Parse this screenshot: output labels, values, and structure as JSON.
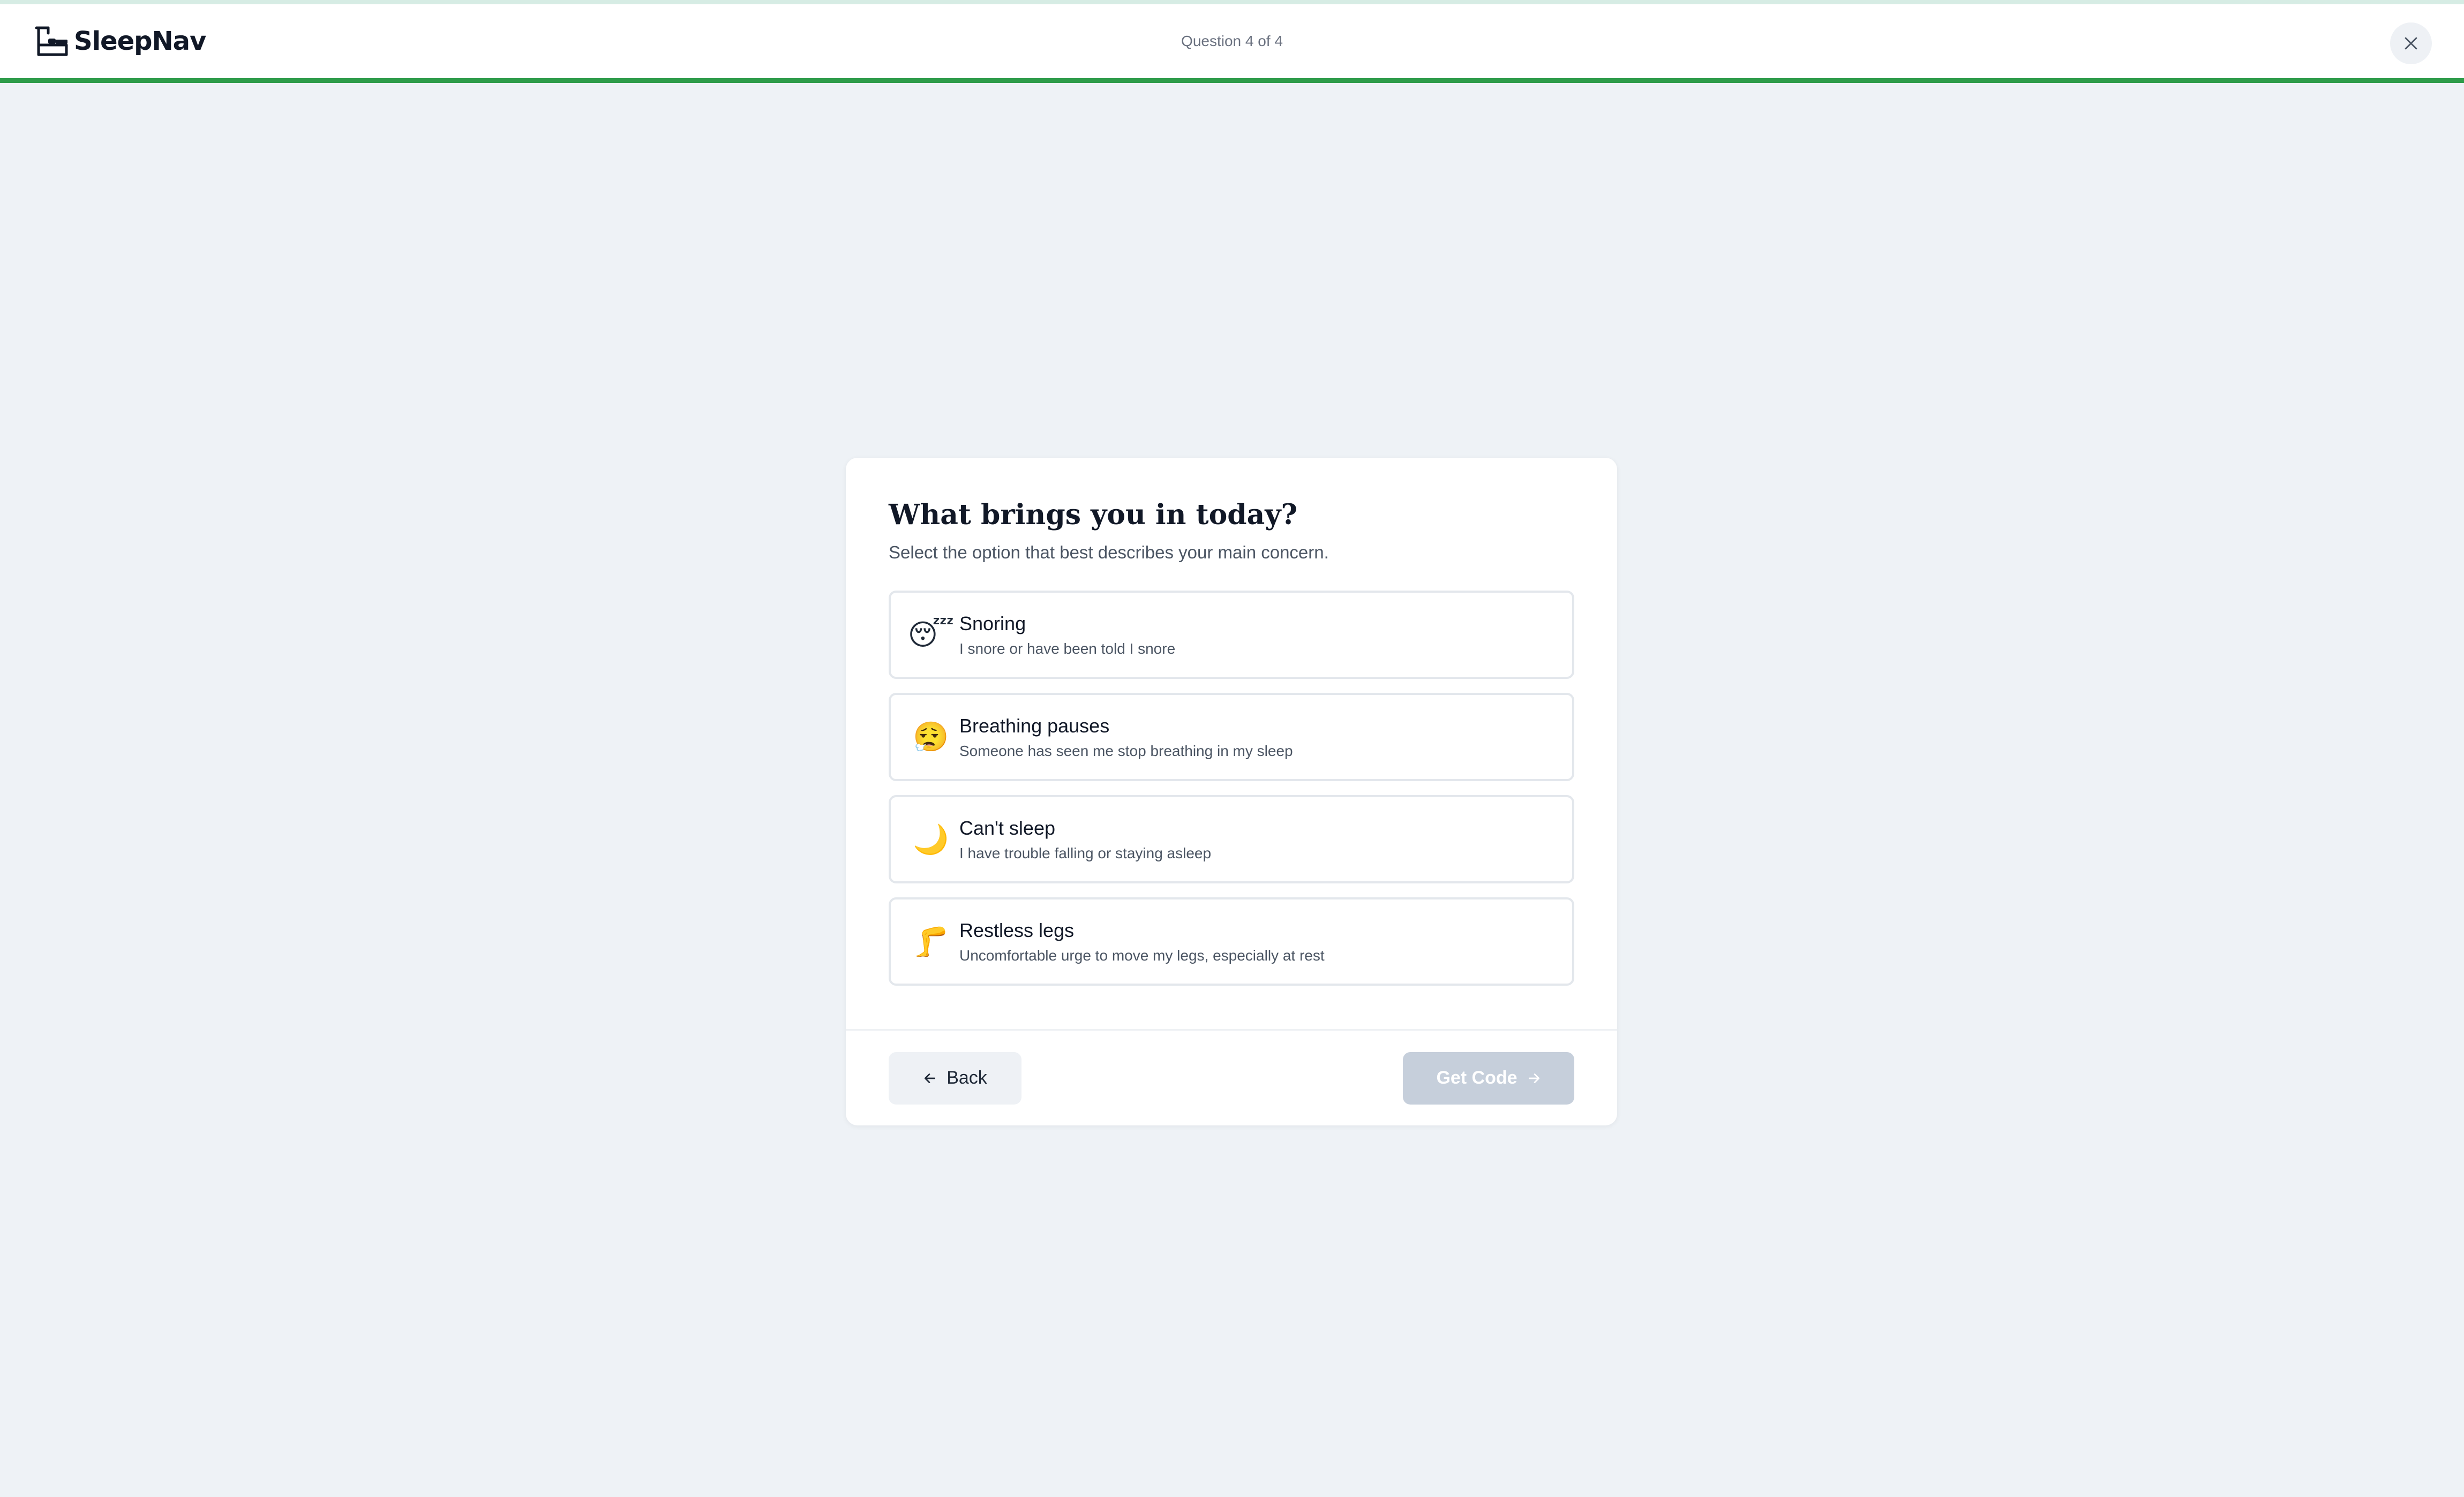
{
  "app": {
    "brand": "SleepNav",
    "logo_icon": "bed-lamp-icon",
    "close_icon": "close-icon",
    "accent_color": "#2e9c4a"
  },
  "header": {
    "counter": "Question 4 of 4",
    "progress": 1.0
  },
  "question": {
    "title": "What brings you in today?",
    "subtitle": "Select the option that best describes your main concern.",
    "options": [
      {
        "emoji": "😴",
        "icon": "sleeping-face-icon",
        "label": "Snoring",
        "description": "I snore or have been told I snore"
      },
      {
        "emoji": "😮‍💨",
        "icon": "exhaling-face-icon",
        "label": "Breathing pauses",
        "description": "Someone has seen me stop breathing in my sleep"
      },
      {
        "emoji": "🌙",
        "icon": "crescent-moon-icon",
        "label": "Can't sleep",
        "description": "I have trouble falling or staying asleep"
      },
      {
        "emoji": "🦵",
        "icon": "leg-icon",
        "label": "Restless legs",
        "description": "Uncomfortable urge to move my legs, especially at rest"
      }
    ]
  },
  "footer": {
    "back_label": "Back",
    "back_icon": "arrow-left-icon",
    "next_label": "Get Code",
    "next_icon": "arrow-right-icon",
    "next_disabled": true
  }
}
